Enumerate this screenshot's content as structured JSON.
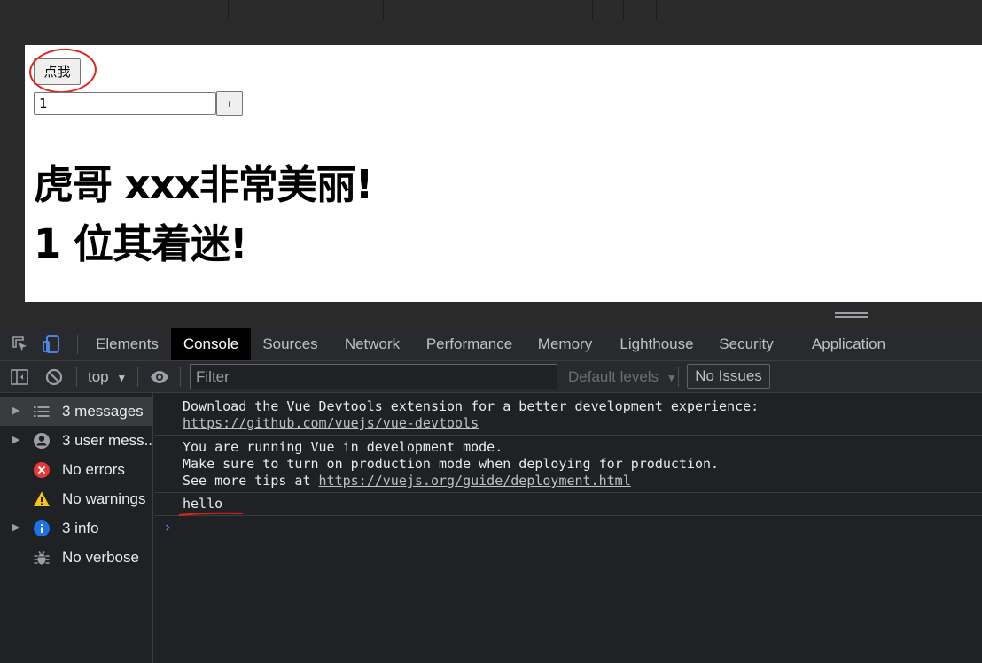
{
  "page": {
    "click_button_label": "点我",
    "counter_input_value": "1",
    "plus_button_label": "+",
    "heading_line1": "虎哥 xxx非常美丽!",
    "heading_line2": "1 位其着迷!"
  },
  "devtools": {
    "tabs": [
      {
        "label": "Elements"
      },
      {
        "label": "Console"
      },
      {
        "label": "Sources"
      },
      {
        "label": "Network"
      },
      {
        "label": "Performance"
      },
      {
        "label": "Memory"
      },
      {
        "label": "Lighthouse"
      },
      {
        "label": "Security"
      },
      {
        "label": "Application"
      }
    ],
    "active_tab": "Console",
    "toolbar": {
      "context": "top",
      "filter_placeholder": "Filter",
      "levels": "Default levels",
      "issues": "No Issues"
    },
    "sidebar": [
      {
        "label": "3 messages",
        "icon": "list-icon"
      },
      {
        "label": "3 user mess...",
        "icon": "user-icon"
      },
      {
        "label": "No errors",
        "icon": "error-icon"
      },
      {
        "label": "No warnings",
        "icon": "warning-icon"
      },
      {
        "label": "3 info",
        "icon": "info-icon"
      },
      {
        "label": "No verbose",
        "icon": "bug-icon"
      }
    ],
    "messages": [
      {
        "lines": [
          "Download the Vue Devtools extension for a better development experience:"
        ],
        "link": "https://github.com/vuejs/vue-devtools"
      },
      {
        "lines": [
          "You are running Vue in development mode.",
          "Make sure to turn on production mode when deploying for production."
        ],
        "prefix": "See more tips at ",
        "link": "https://vuejs.org/guide/deployment.html"
      },
      {
        "lines": [
          "hello"
        ]
      }
    ],
    "prompt": "›"
  },
  "colors": {
    "annotation": "#e2231a",
    "active_tab_bg": "#000000",
    "panel_bg": "#202124",
    "info_blue": "#1a73e8",
    "error_red": "#e53935",
    "warning_yellow": "#f5c518"
  }
}
